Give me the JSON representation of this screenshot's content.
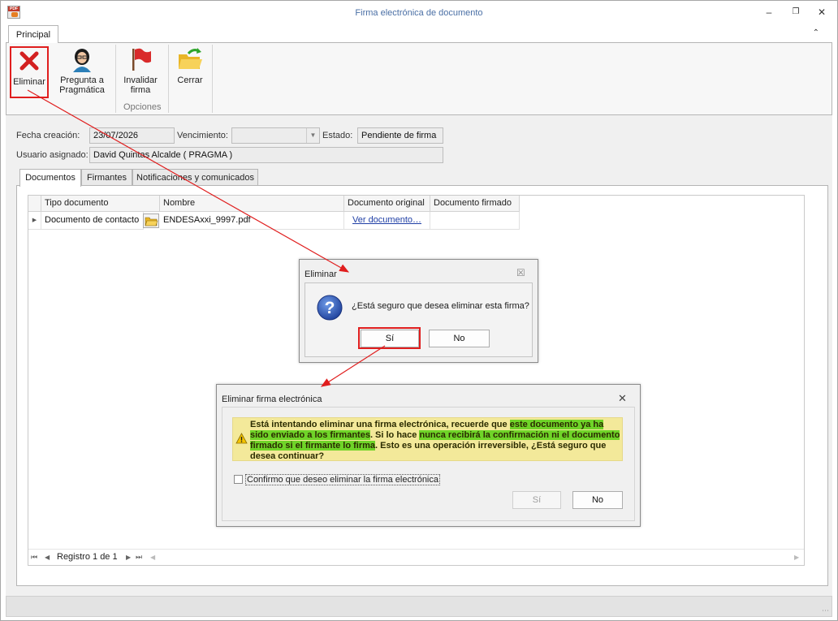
{
  "window": {
    "title": "Firma electrónica de documento"
  },
  "ribbon": {
    "tab_label": "Principal",
    "buttons": {
      "eliminar": "Eliminar",
      "pregunta_line1": "Pregunta a",
      "pregunta_line2": "Pragmática",
      "invalidar_line1": "Invalidar",
      "invalidar_line2": "firma",
      "cerrar": "Cerrar"
    },
    "group_label": "Opciones"
  },
  "form": {
    "fecha_creacion_label": "Fecha creación:",
    "fecha_creacion_value": "23/07/2026",
    "vencimiento_label": "Vencimiento:",
    "vencimiento_value": "",
    "estado_label": "Estado:",
    "estado_value": "Pendiente de firma",
    "usuario_label": "Usuario asignado:",
    "usuario_value": "David Quintas Alcalde ( PRAGMA )"
  },
  "tabs": [
    "Documentos",
    "Firmantes",
    "Notificaciones y comunicados"
  ],
  "grid": {
    "columns": [
      "Tipo documento",
      "Nombre",
      "Documento original",
      "Documento firmado"
    ],
    "rows": [
      {
        "tipo": "Documento de contacto",
        "nombre": "ENDESAxxi_9997.pdf",
        "original": "Ver documento…",
        "firmado": ""
      }
    ],
    "pager_text": "Registro 1 de 1"
  },
  "dialog_confirm": {
    "title": "Eliminar",
    "message": "¿Está seguro que desea eliminar esta firma?",
    "yes": "Sí",
    "no": "No"
  },
  "dialog_warning": {
    "title": "Eliminar firma electrónica",
    "message_segments": [
      {
        "text": "Está intentando eliminar una firma electrónica, recuerde que ",
        "highlight": false
      },
      {
        "text": "este documento ya ha sido enviado a los firmantes",
        "highlight": true
      },
      {
        "text": ". Si lo hace ",
        "highlight": false
      },
      {
        "text": "nunca recibirá la confirmación ni el documento firmado si el firmante lo firma",
        "highlight": true
      },
      {
        "text": ". Esto es una operación irreversible, ¿Está seguro que desea continuar?",
        "highlight": false
      }
    ],
    "checkbox_label": "Confirmo que deseo eliminar la firma electrónica",
    "checkbox_checked": false,
    "yes": "Sí",
    "no": "No"
  },
  "colors": {
    "annotation_red": "#e01e1e",
    "highlight_green": "#6fd428",
    "warning_yellow": "#f3e99a",
    "title_blue": "#4a6fa5"
  }
}
